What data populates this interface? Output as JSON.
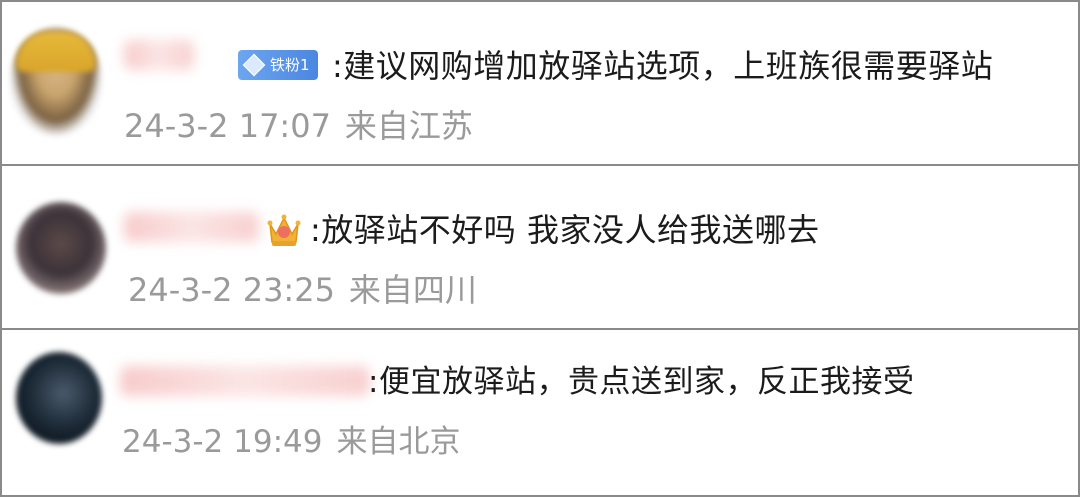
{
  "comments": [
    {
      "badge": "铁粉1",
      "text": ":建议网购增加放驿站选项，上班族很需要驿站",
      "time": "24-3-2 17:07",
      "location": "来自江苏"
    },
    {
      "text": ":放驿站不好吗 我家没人给我送哪去",
      "time": "24-3-2 23:25",
      "location": "来自四川",
      "icon": "crown-icon"
    },
    {
      "text": ":便宜放驿站，贵点送到家，反正我接受",
      "time": "24-3-2 19:49",
      "location": "来自北京"
    }
  ],
  "colors": {
    "badge_bg": "#4b86e0",
    "meta_text": "#9a9a9a",
    "border": "#8a8a8a"
  }
}
